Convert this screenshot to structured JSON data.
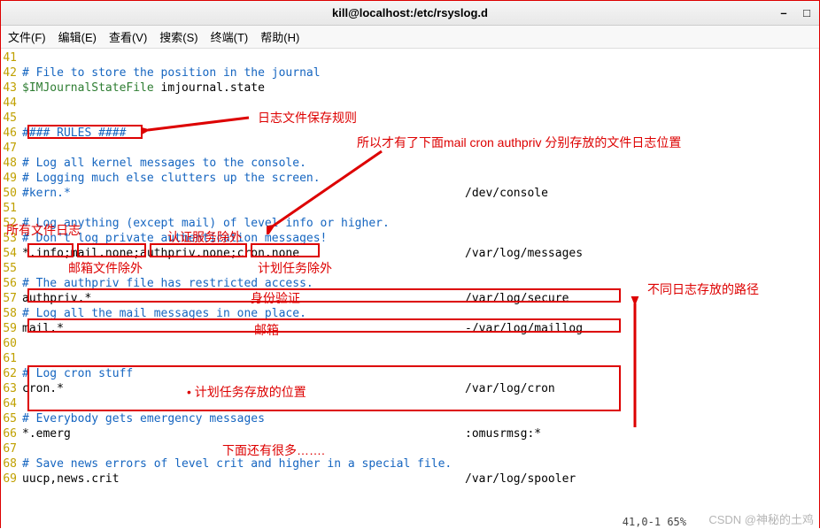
{
  "window": {
    "title": "kill@localhost:/etc/rsyslog.d",
    "minimize": "–",
    "maximize": "□",
    "close": "×"
  },
  "menu": {
    "file": "文件(F)",
    "edit": "编辑(E)",
    "view": "查看(V)",
    "search": "搜索(S)",
    "terminal": "终端(T)",
    "help": "帮助(H)"
  },
  "lines": {
    "41": "",
    "42": "# File to store the position in the journal",
    "43_a": "$IMJournalStateFile ",
    "43_b": "imjournal.state",
    "44": "",
    "45": "",
    "46": "#### RULES ####",
    "47": "",
    "48": "# Log all kernel messages to the console.",
    "49": "# Logging much else clutters up the screen.",
    "50_a": "#kern.*",
    "50_b": "/dev/console",
    "51": "",
    "52": "# Log anything (except mail) of level info or higher.",
    "53": "# Don't log private authentication messages!",
    "54_a": "*.info;mail.none;authpriv.none;cron.none",
    "54_b": "/var/log/messages",
    "55": "",
    "56": "# The authpriv file has restricted access.",
    "57_a": "authpriv.*",
    "57_b": "/var/log/secure",
    "58": "# Log all the mail messages in one place.",
    "59_a": "mail.*",
    "59_b": "-/var/log/maillog",
    "60": "",
    "61": "",
    "62": "# Log cron stuff",
    "63_a": "cron.*",
    "63_b": "/var/log/cron",
    "64": "",
    "65": "# Everybody gets emergency messages",
    "66_a": "*.emerg",
    "66_b": ":omusrmsg:*",
    "67": "",
    "68": "# Save news errors of level crit and higher in a special file.",
    "69_a": "uucp,news.crit",
    "69_b": "/var/log/spooler"
  },
  "anno": {
    "a1": "日志文件保存规则",
    "a2": "所以才有了下面mail cron authpriv 分别存放的文件日志位置",
    "a3": "所有文件日志",
    "a4": "认证服务除外",
    "a5": "邮箱文件除外",
    "a6": "计划任务除外",
    "a7": "身份验证",
    "a8": "邮箱",
    "a9": "• 计划任务存放的位置",
    "a10": "下面还有很多…….",
    "a11": "不同日志存放的路径"
  },
  "status": "41,0-1        65%",
  "watermark": "CSDN @神秘的土鸡"
}
